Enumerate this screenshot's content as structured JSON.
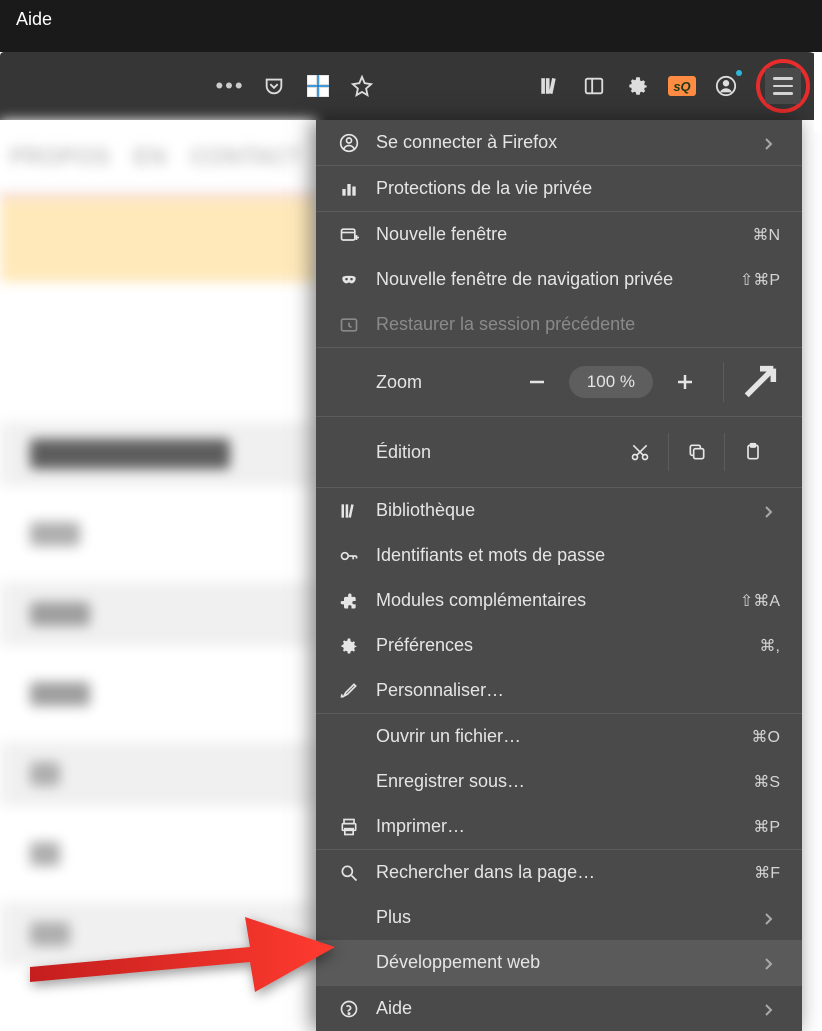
{
  "window": {
    "title": "Aide"
  },
  "site_nav": {
    "propos": "PROPOS",
    "en": "EN",
    "contact": "CONTACT"
  },
  "menu": {
    "signin": "Se connecter à Firefox",
    "privacy": "Protections de la vie privée",
    "new_window": "Nouvelle fenêtre",
    "new_window_kbd": "⌘N",
    "private_window": "Nouvelle fenêtre de navigation privée",
    "private_window_kbd": "⇧⌘P",
    "restore_session": "Restaurer la session précédente",
    "zoom_label": "Zoom",
    "zoom_value": "100 %",
    "edit_label": "Édition",
    "library": "Bibliothèque",
    "logins": "Identifiants et mots de passe",
    "addons": "Modules complémentaires",
    "addons_kbd": "⇧⌘A",
    "prefs": "Préférences",
    "prefs_kbd": "⌘,",
    "customize": "Personnaliser…",
    "open_file": "Ouvrir un fichier…",
    "open_file_kbd": "⌘O",
    "save_as": "Enregistrer sous…",
    "save_as_kbd": "⌘S",
    "print": "Imprimer…",
    "print_kbd": "⌘P",
    "find": "Rechercher dans la page…",
    "find_kbd": "⌘F",
    "more": "Plus",
    "webdev": "Développement web",
    "help": "Aide"
  }
}
